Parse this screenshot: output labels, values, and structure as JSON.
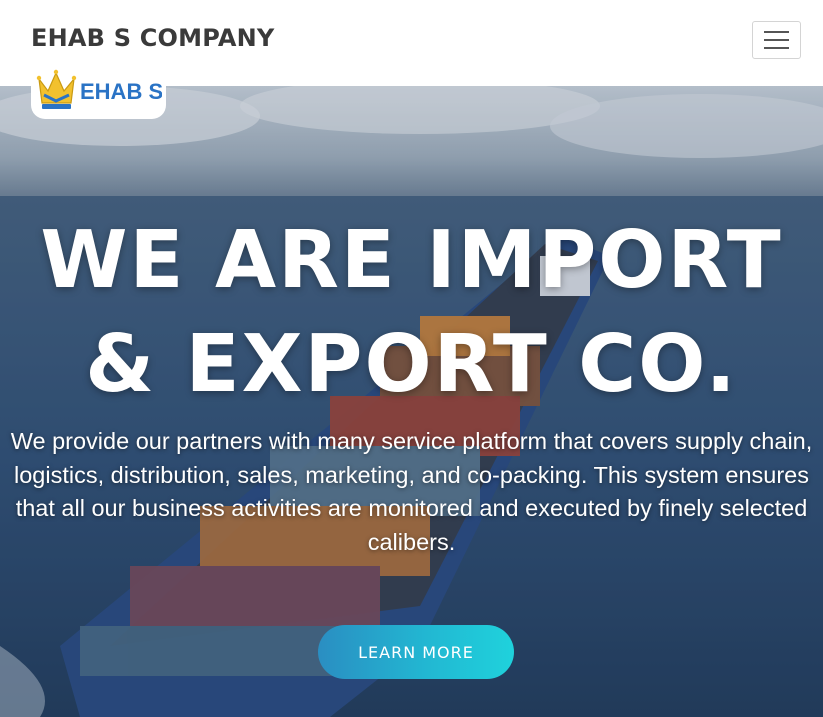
{
  "navbar": {
    "brand": "EHAB S COMPANY",
    "menu_icon": "hamburger-menu-icon"
  },
  "logo": {
    "text": "EHAB S",
    "icon": "crown-icon",
    "colors": {
      "crown": "#f2c12e",
      "text": "#2a73c5"
    }
  },
  "hero": {
    "headline_line1": "WE ARE IMPORT",
    "headline_line2": "& EXPORT CO.",
    "description": "We provide our partners with many service platform that covers supply chain, logistics, distribution, sales, marketing, and co-packing. This system ensures that all our business activities are monitored and executed by finely selected calibers.",
    "cta_label": "LEARN MORE",
    "background": "container-ship-at-sea-image"
  },
  "colors": {
    "brand_text": "#3a3a3a",
    "cta_gradient_start": "#2a8ec2",
    "cta_gradient_end": "#1fd2dc"
  }
}
